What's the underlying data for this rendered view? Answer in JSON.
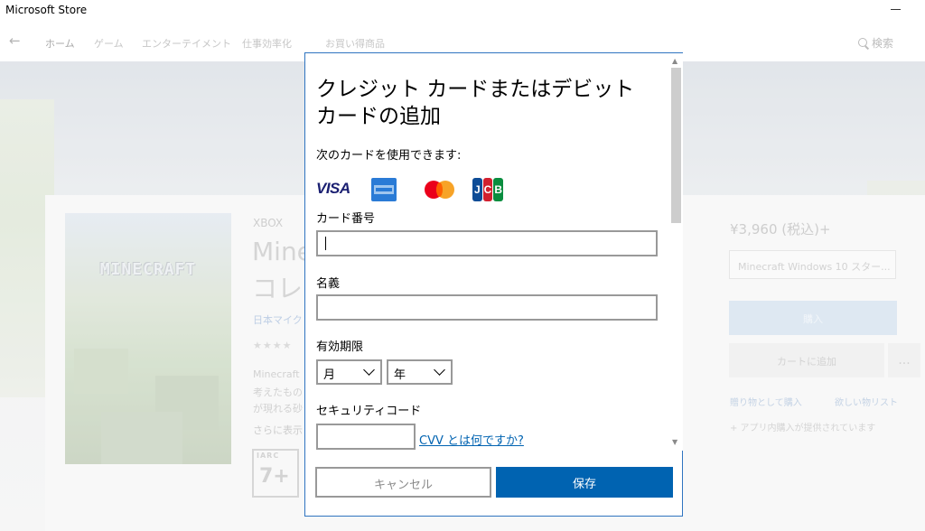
{
  "window": {
    "title": "Microsoft Store"
  },
  "nav": {
    "back_glyph": "←",
    "tabs": [
      "ホーム",
      "ゲーム",
      "エンターテイメント",
      "仕事効率化",
      "お買い得商品"
    ],
    "search_label": "検索"
  },
  "product": {
    "cover_logo": "MINECRAFT",
    "platform": "XBOX",
    "title_line1": "Minecraft",
    "title_line2": "コレク",
    "publisher": "日本マイク",
    "stars": "★★★★",
    "description": [
      "Minecraft",
      "考えたもの",
      "が現れる砂"
    ],
    "more_link": "さらに表示",
    "rating_org": "IARC",
    "rating_age": "7+",
    "price": "¥3,960 (税込)+",
    "edition": "Minecraft Windows 10 スター...",
    "buy_label": "購入",
    "cart_label": "カートに追加",
    "more_label": "...",
    "gift_label": "贈り物として購入",
    "wishlist_label": "欲しい物リスト",
    "iap_note": "+ アプリ内購入が提供されています"
  },
  "dialog": {
    "title": "クレジット カードまたはデビット カードの追加",
    "subtitle": "次のカードを使用できます:",
    "card_brands": [
      "VISA",
      "American Express",
      "Mastercard",
      "JCB"
    ],
    "card_number_label": "カード番号",
    "card_number_value": "",
    "name_label": "名義",
    "name_value": "",
    "expiry_label": "有効期限",
    "month_selected": "月",
    "year_selected": "年",
    "security_label": "セキュリティコード",
    "security_value": "",
    "cvv_help_link": "CVV とは何ですか?",
    "cancel_label": "キャンセル",
    "save_label": "保存"
  },
  "colors": {
    "accent": "#0063b1",
    "dialog_border": "#2f74c0",
    "input_border": "#999999"
  }
}
